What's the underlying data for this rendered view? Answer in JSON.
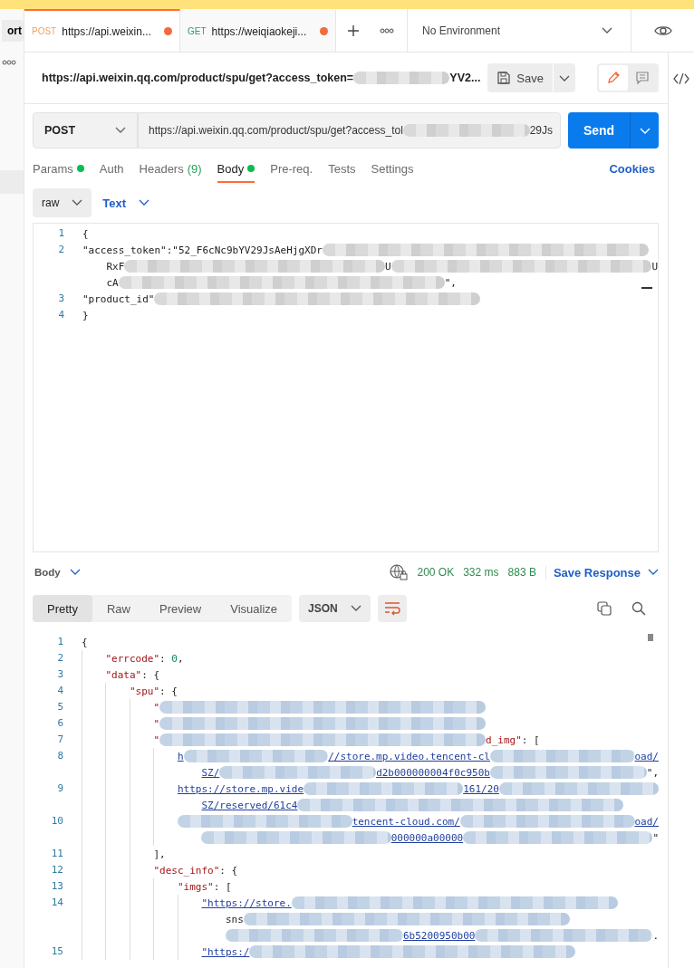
{
  "sidebar": {
    "import_button": "ort"
  },
  "tabs": [
    {
      "method": "POST",
      "url": "https://api.weixin...",
      "unsaved": true,
      "selected": true
    },
    {
      "method": "GET",
      "url": "https://weiqiaokeji...",
      "unsaved": true,
      "selected": false
    }
  ],
  "environment": "No Environment",
  "request": {
    "title": [
      {
        "kind": "text",
        "text": "https://api.weixin.qq.com/product/spu/get?access_token="
      },
      {
        "kind": "redacted"
      },
      {
        "kind": "text",
        "text": "YV2..."
      }
    ],
    "save_button": "Save",
    "modes": [
      {
        "kind": "edit",
        "selected": true
      },
      {
        "kind": "comment",
        "selected": false
      }
    ],
    "method": "POST",
    "url": [
      {
        "kind": "text",
        "text": "https://api.weixin.qq.com/product/spu/get?access_tol"
      },
      {
        "kind": "redacted"
      },
      {
        "kind": "text",
        "text": "29Js"
      }
    ],
    "send_button": "Send",
    "tabs": [
      {
        "label": "Params",
        "dot": true,
        "selected": false
      },
      {
        "label": "Auth",
        "dot": false,
        "selected": false
      },
      {
        "label": "Headers",
        "count": "(9)",
        "dot": false,
        "selected": false
      },
      {
        "label": "Body",
        "dot": true,
        "selected": true
      },
      {
        "label": "Pre-req.",
        "dot": false,
        "selected": false
      },
      {
        "label": "Tests",
        "dot": false,
        "selected": false
      },
      {
        "label": "Settings",
        "dot": false,
        "selected": false
      }
    ],
    "cookies": "Cookies",
    "body_mode": "raw",
    "body_type": "Text",
    "body_lines": [
      {
        "number": "1",
        "rows": [
          [
            {
              "kind": "punct",
              "text": "{"
            }
          ]
        ]
      },
      {
        "number": "2",
        "rows": [
          [
            {
              "kind": "punct",
              "text": "\"access_token\":\"52_F6cNc9bYV29JsAeHjgXDr"
            },
            {
              "kind": "redacted"
            }
          ],
          [
            {
              "kind": "punct",
              "text": "    RxF"
            },
            {
              "kind": "redacted"
            },
            {
              "kind": "punct",
              "text": "U"
            },
            {
              "kind": "redacted"
            },
            {
              "kind": "punct",
              "text": "U"
            }
          ],
          [
            {
              "kind": "punct",
              "text": "    cA"
            },
            {
              "kind": "redacted"
            },
            {
              "kind": "punct",
              "text": "\","
            }
          ]
        ]
      },
      {
        "number": "3",
        "rows": [
          [
            {
              "kind": "punct",
              "text": "\"product_id\""
            },
            {
              "kind": "redacted"
            }
          ]
        ]
      },
      {
        "number": "4",
        "rows": [
          [
            {
              "kind": "punct",
              "text": "}"
            }
          ]
        ]
      }
    ]
  },
  "response": {
    "label": "Body",
    "status": "200 OK",
    "time": "332 ms",
    "size": "883 B",
    "save_button": "Save Response",
    "views": [
      {
        "label": "Pretty",
        "selected": true
      },
      {
        "label": "Raw",
        "selected": false
      },
      {
        "label": "Preview",
        "selected": false
      },
      {
        "label": "Visualize",
        "selected": false
      }
    ],
    "format": "JSON",
    "lines": [
      {
        "number": "1",
        "rows": [
          [
            {
              "kind": "punct",
              "text": "{"
            }
          ]
        ]
      },
      {
        "number": "2",
        "rows": [
          [
            {
              "kind": "punct",
              "text": "    "
            },
            {
              "kind": "key",
              "text": "\"errcode\""
            },
            {
              "kind": "punct",
              "text": ": "
            },
            {
              "kind": "num",
              "text": "0"
            },
            {
              "kind": "punct",
              "text": ","
            }
          ]
        ]
      },
      {
        "number": "3",
        "rows": [
          [
            {
              "kind": "punct",
              "text": "    "
            },
            {
              "kind": "key",
              "text": "\"data\""
            },
            {
              "kind": "punct",
              "text": ": {"
            }
          ]
        ]
      },
      {
        "number": "4",
        "rows": [
          [
            {
              "kind": "punct",
              "text": "        "
            },
            {
              "kind": "key",
              "text": "\"spu\""
            },
            {
              "kind": "punct",
              "text": ": {"
            }
          ]
        ]
      },
      {
        "number": "5",
        "rows": [
          [
            {
              "kind": "punct",
              "text": "            "
            },
            {
              "kind": "key",
              "text": "\""
            },
            {
              "kind": "redacted"
            }
          ]
        ]
      },
      {
        "number": "6",
        "rows": [
          [
            {
              "kind": "punct",
              "text": "            "
            },
            {
              "kind": "key",
              "text": "\""
            },
            {
              "kind": "redacted"
            }
          ]
        ]
      },
      {
        "number": "7",
        "rows": [
          [
            {
              "kind": "punct",
              "text": "            "
            },
            {
              "kind": "key",
              "text": "\""
            },
            {
              "kind": "redacted"
            },
            {
              "kind": "key",
              "text": "d_img\""
            },
            {
              "kind": "punct",
              "text": ": ["
            }
          ]
        ]
      },
      {
        "number": "8",
        "rows": [
          [
            {
              "kind": "punct",
              "text": "                "
            },
            {
              "kind": "url",
              "text": "h"
            },
            {
              "kind": "redacted"
            },
            {
              "kind": "url",
              "text": "//store.mp.video.tencent-cl"
            },
            {
              "kind": "redacted"
            },
            {
              "kind": "url",
              "text": "oad/"
            }
          ],
          [
            {
              "kind": "punct",
              "text": "                    "
            },
            {
              "kind": "url",
              "text": "SZ/"
            },
            {
              "kind": "redacted"
            },
            {
              "kind": "url",
              "text": "d2b000000004f0c950b"
            },
            {
              "kind": "redacted"
            },
            {
              "kind": "punct",
              "text": "\","
            }
          ]
        ]
      },
      {
        "number": "9",
        "rows": [
          [
            {
              "kind": "punct",
              "text": "                "
            },
            {
              "kind": "url",
              "text": "https://store.mp.vide"
            },
            {
              "kind": "redacted"
            },
            {
              "kind": "url",
              "text": "161/20"
            },
            {
              "kind": "redacted"
            }
          ],
          [
            {
              "kind": "punct",
              "text": "                    "
            },
            {
              "kind": "url",
              "text": "SZ/reserved/61c4"
            },
            {
              "kind": "redacted"
            }
          ]
        ]
      },
      {
        "number": "10",
        "rows": [
          [
            {
              "kind": "punct",
              "text": "                "
            },
            {
              "kind": "redacted"
            },
            {
              "kind": "url",
              "text": "tencent-cloud.com/"
            },
            {
              "kind": "redacted"
            },
            {
              "kind": "url",
              "text": "oad/"
            }
          ],
          [
            {
              "kind": "punct",
              "text": "                    "
            },
            {
              "kind": "redacted"
            },
            {
              "kind": "url",
              "text": "000000a00000"
            },
            {
              "kind": "redacted"
            },
            {
              "kind": "punct",
              "text": "\""
            }
          ]
        ]
      },
      {
        "number": "11",
        "rows": [
          [
            {
              "kind": "punct",
              "text": "            ],"
            }
          ]
        ]
      },
      {
        "number": "12",
        "rows": [
          [
            {
              "kind": "punct",
              "text": "            "
            },
            {
              "kind": "key",
              "text": "\"desc_info\""
            },
            {
              "kind": "punct",
              "text": ": {"
            }
          ]
        ]
      },
      {
        "number": "13",
        "rows": [
          [
            {
              "kind": "punct",
              "text": "                "
            },
            {
              "kind": "key",
              "text": "\"imgs\""
            },
            {
              "kind": "punct",
              "text": ": ["
            }
          ]
        ]
      },
      {
        "number": "14",
        "rows": [
          [
            {
              "kind": "punct",
              "text": "                    "
            },
            {
              "kind": "url",
              "text": "\"https://store."
            },
            {
              "kind": "redacted"
            }
          ],
          [
            {
              "kind": "punct",
              "text": "                        sns"
            },
            {
              "kind": "redacted"
            }
          ],
          [
            {
              "kind": "punct",
              "text": "                        "
            },
            {
              "kind": "redacted"
            },
            {
              "kind": "url",
              "text": "6b5200950b00"
            },
            {
              "kind": "redacted"
            },
            {
              "kind": "punct",
              "text": "."
            }
          ]
        ]
      },
      {
        "number": "15",
        "rows": [
          [
            {
              "kind": "punct",
              "text": "                    "
            },
            {
              "kind": "url",
              "text": "\"https:/"
            },
            {
              "kind": "redacted"
            }
          ]
        ]
      }
    ]
  }
}
